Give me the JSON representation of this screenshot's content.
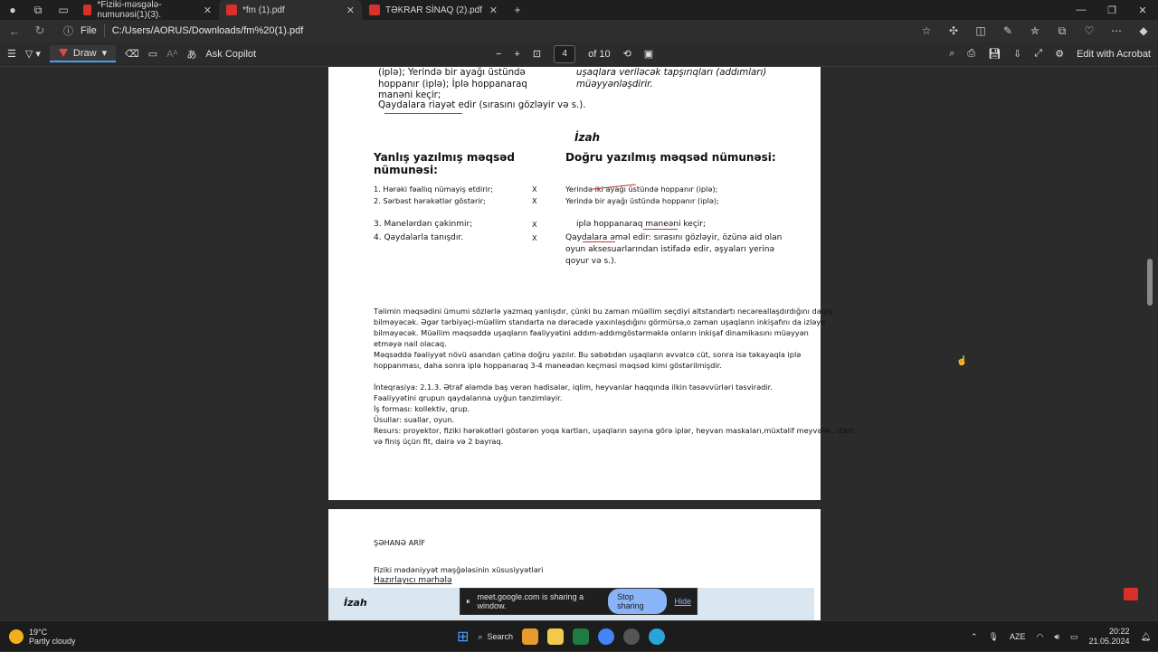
{
  "tabs": [
    {
      "title": "*Fiziki-məsgələ-numunəsi(1)(3).",
      "active": false
    },
    {
      "title": "*fm (1).pdf",
      "active": true
    },
    {
      "title": "TƏKRAR SİNAQ (2).pdf",
      "active": false
    }
  ],
  "address": {
    "scheme": "File",
    "url": "C:/Users/AORUS/Downloads/fm%20(1).pdf"
  },
  "pdf_toolbar": {
    "draw": "Draw",
    "copilot": "Ask Copilot",
    "page_current": "4",
    "page_total": "of 10",
    "edit_acrobat": "Edit with Acrobat"
  },
  "page1": {
    "top_left": [
      "(iplə);  Yerində  bir  ayağı  üstündə",
      "hoppanır  (iplə);  İplə  hoppanaraq",
      "manəni keçir;",
      "Qaydalara riayət edir (sırasını gözləyir və s.)."
    ],
    "top_right": [
      "uşaqlara veriləcək tapşırıqları (addımları)",
      "müəyyənləşdirir."
    ],
    "izah": "İzah",
    "wrong_heading": [
      "Yanlış yazılmış məqsəd",
      "nümunəsi:"
    ],
    "right_heading": "Doğru yazılmış məqsəd nümunəsi:",
    "wrong_list": [
      "1. Hərəki fəallıq nümayiş etdirir;",
      "2. Sərbəst hərəkətlər göstərir;",
      "3. Manelərdən çəkinmir;",
      "4.  Qaydalarla tanışdır."
    ],
    "mark": "X",
    "right_list": [
      "Yerində iki ayağı üstündə hoppanır (iplə);",
      "Yerində bir ayağı üstündə hoppanır (iplə);",
      "iplə hoppanaraq maneəni keçir;",
      "Qaydalara əməl edir: sırasını gözləyir, özünə aid olan",
      "oyun aksesuarlarından istifadə edir, əşyaları yerinə",
      "qoyur və s.)."
    ],
    "paragraph": [
      "Təlimin məqsədini ümumi sözlərlə yazmaq yanlışdır, çünki bu zaman müəllim seçdiyi altstandartı necəreallaşdırdığını dəqiq",
      "bilməyəcək. Əgər tərbiyəçi-müəllim standarta nə dərəcədə yaxınlaşdığını görmürsə,o zaman uşaqların inkişafını da izləyə",
      "bilməyəcək. Müəllim məqsəddə uşaqların fəaliyyətini addım-addımgöstərməklə onların inkişaf dinamikasını müəyyən",
      "etməyə nail olacaq.",
      "Məqsəddə fəaliyyət növü asandan çətinə doğru yazılır. Bu səbəbdən uşaqların əvvəlcə cüt, sonra isə təkayaqla iplə",
      "hoppanması, daha sonra iplə hoppanaraq 3-4 maneədən keçməsi məqsəd kimi göstərilmişdir."
    ],
    "details": [
      "İnteqrasiya:  2.1.3.  Ətraf aləmdə baş verən hadisələr, iqlim, heyvanlar haqqında ilkin təsəvvürləri təsvirədir.",
      "Fəaliyyətini qrupun qaydalarına uyğun tənzimləyir.",
      "İş forması: kollektiv, qrup.",
      "Üsullar: suallar, oyun.",
      "Resurs: proyektor, fiziki hərəkətləri göstərən yoqa kartları, uşaqların sayına görə iplər, heyvan maskaları,müxtəlif meyvələr, start",
      "və finiş üçün fit, dairə və 2 bayraq."
    ]
  },
  "page2": {
    "author": "ŞƏHANƏ ARİF",
    "subject": "Fiziki mədəniyyət məşğələsinin xüsusiyyətləri",
    "stage": "Hazırlayıcı mərhələ",
    "izah": "İzah"
  },
  "share_bar": {
    "text": "meet.google.com is sharing a window.",
    "stop": "Stop sharing",
    "hide": "Hide"
  },
  "taskbar": {
    "temp": "19°C",
    "weather": "Partly cloudy",
    "search": "Search",
    "lang": "AZE",
    "time": "20:22",
    "date": "21.05.2024"
  },
  "colors": {
    "accent": "#4c9ff0",
    "pdf_red": "#d9302c",
    "annotation_red": "#c0392b",
    "share_blue": "#8ab4f8"
  }
}
